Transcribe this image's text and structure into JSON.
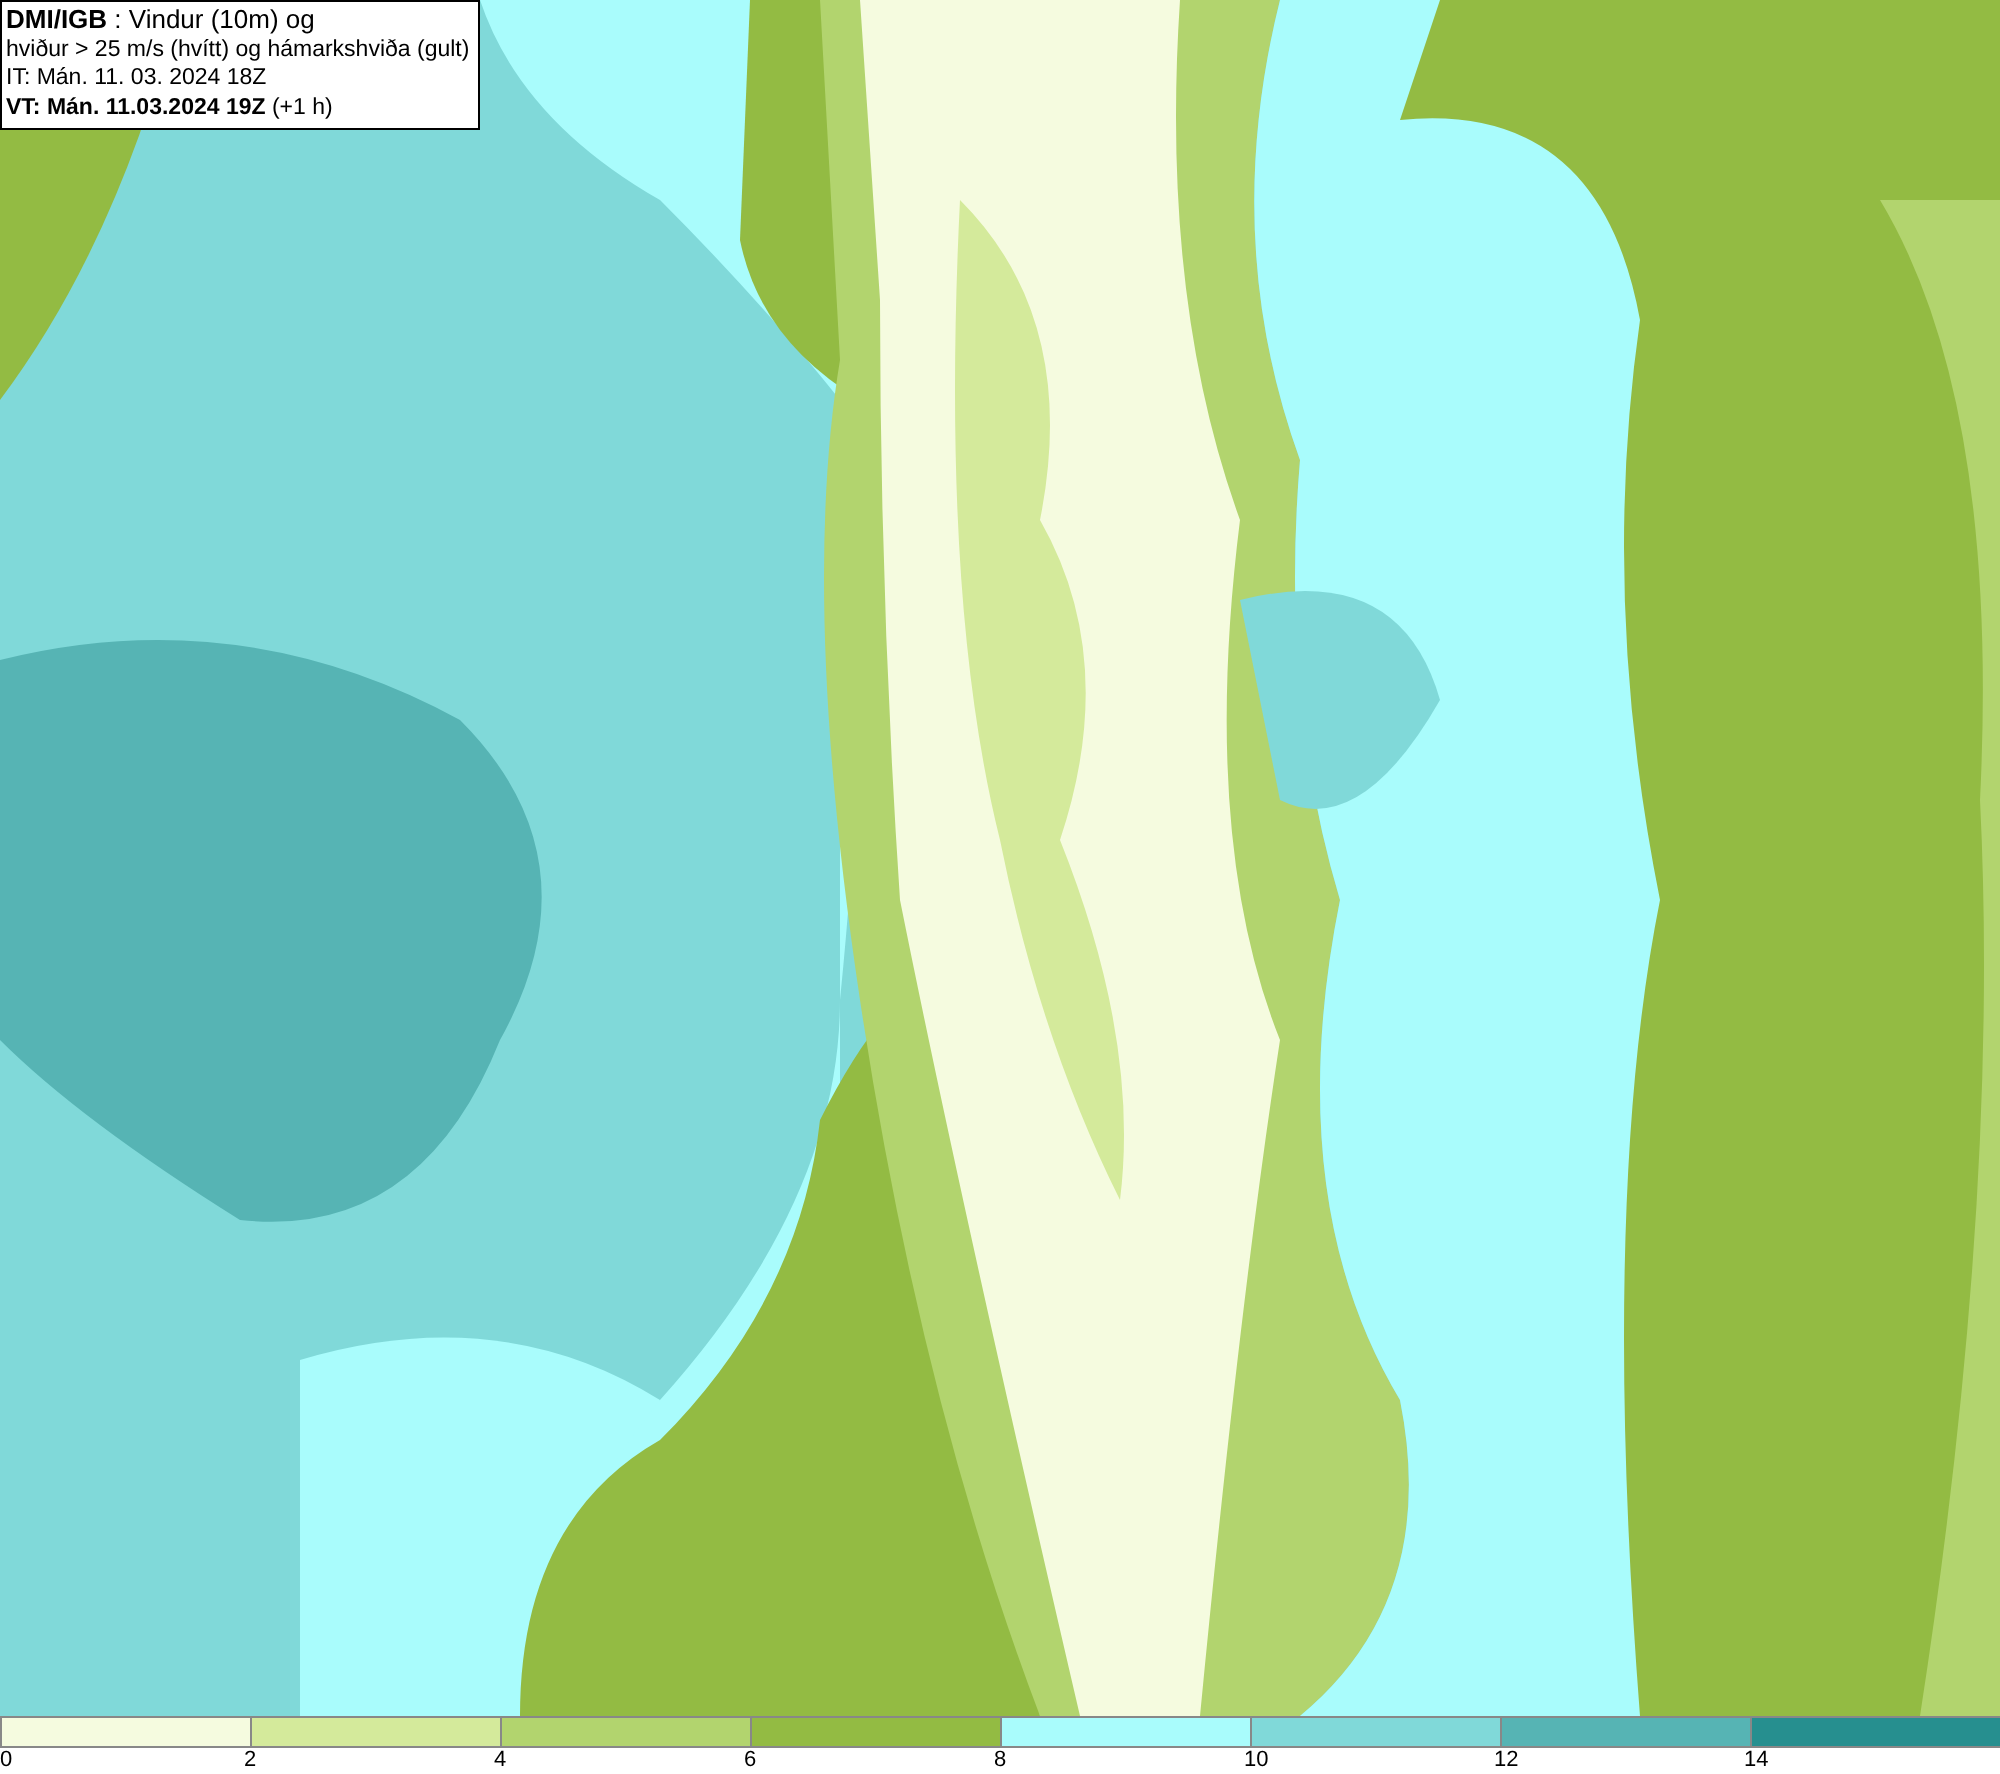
{
  "info_box": {
    "lines": [
      "**DMI/IGB** : Vindur (10m) og",
      "hviður > 25 m/s (hvítt) og hámarkshviða (gult)",
      "IT: Mán. 11. 03. 2024 18Z",
      "**VT: Mán. 11.03.2024 19Z** (+1 h)"
    ]
  },
  "legend": [
    {
      "label": "0",
      "color": "#f5fbdf"
    },
    {
      "label": "2",
      "color": "#d4ea9b"
    },
    {
      "label": "4",
      "color": "#b2d46e"
    },
    {
      "label": "6",
      "color": "#93bb43"
    },
    {
      "label": "8",
      "color": "#a9fcfc"
    },
    {
      "label": "10",
      "color": "#80d9d9"
    },
    {
      "label": "12",
      "color": "#56b4b4"
    },
    {
      "label": "14",
      "color": "#268f8f"
    }
  ]
}
